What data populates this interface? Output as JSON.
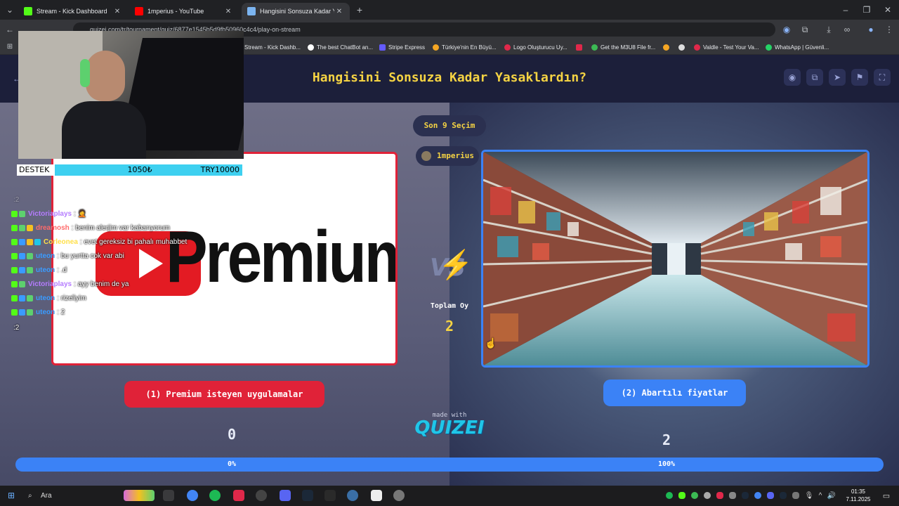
{
  "browser": {
    "tabs": [
      {
        "label": "Stream - Kick Dashboard",
        "favicon_color": "#53fc18"
      },
      {
        "label": "1mperius - YouTube",
        "favicon_color": "#ff0000"
      },
      {
        "label": "Hangisini Sonsuza Kadar Yasakl",
        "favicon_color": "#7bb4f0"
      }
    ],
    "new_tab_icon": "plus-icon",
    "url": "quizei.com/tr/tournament/quiz/6877e1545b5d9fb50960c4c4/play-on-stream",
    "bookmarks": [
      {
        "label": "Stream - Kick Dashb...",
        "color": "#53fc18"
      },
      {
        "label": "The best ChatBot an...",
        "color": "#ffffff"
      },
      {
        "label": "Stripe Express",
        "color": "#635bff"
      },
      {
        "label": "Türkiye'nin En Büyü...",
        "color": "#f5a623"
      },
      {
        "label": "Logo Oluşturucu Uy...",
        "color": "#e0284a"
      },
      {
        "label": "",
        "color": "#e0284a"
      },
      {
        "label": "Get the M3U8 File fr...",
        "color": "#3cba54"
      },
      {
        "label": "",
        "color": "#f5a623"
      },
      {
        "label": "",
        "color": "#dddddd"
      },
      {
        "label": "Valdle - Test Your Va...",
        "color": "#e0284a"
      },
      {
        "label": "WhatsApp | Güvenli...",
        "color": "#25d366"
      }
    ]
  },
  "quiz": {
    "title": "Hangisini Sonsuza Kadar Yasaklardın?",
    "last_pick_badge": "Son 9 Seçim",
    "user_badge": "1mperius",
    "vs_label": "VS",
    "total_votes_label": "Toplam Oy",
    "total_votes": "2",
    "left_option": {
      "label": "(1) Premium isteyen uygulamalar",
      "score": "0",
      "percent": "0%",
      "image_text": "Premium",
      "accent": "#e02238"
    },
    "right_option": {
      "label": "(2) Abartılı fiyatlar",
      "score": "2",
      "percent": "100%",
      "accent": "#3b82f6"
    },
    "left_share": 0,
    "made_with": "made with",
    "brand": "QUIZEI",
    "controls": [
      "eye-icon",
      "copy-icon",
      "send-icon",
      "flag-icon",
      "fullscreen-icon"
    ]
  },
  "overlay": {
    "donation": {
      "label": "DESTEK",
      "amount": "1050₺",
      "goal": "TRY10000"
    },
    "chat": [
      {
        "user": "",
        "message": ":2",
        "user_color": "#dddddd"
      },
      {
        "user": "Victoriaplays",
        "message": ": 🤦",
        "user_color": "#b57cff"
      },
      {
        "user": "dreamosh",
        "message": ": benim alerjim var kabarıyorum",
        "user_color": "#ff6a6a"
      },
      {
        "user": "Corleonea",
        "message": ": evet gereksiz bi pahalı muhabbet",
        "user_color": "#ffe04a"
      },
      {
        "user": "uteon",
        "message": ": bu yurtta cok var abi",
        "user_color": "#3a9bff"
      },
      {
        "user": "uteon",
        "message": ": .d",
        "user_color": "#3a9bff"
      },
      {
        "user": "Victoriaplays",
        "message": ": ayy benim de ya",
        "user_color": "#b57cff"
      },
      {
        "user": "uteon",
        "message": ": rizeliyim",
        "user_color": "#3a9bff"
      },
      {
        "user": "uteon",
        "message": ": 2",
        "user_color": "#3a9bff"
      },
      {
        "user": "",
        "message": ":2",
        "user_color": "#dddddd"
      }
    ]
  },
  "taskbar": {
    "search_placeholder": "Ara",
    "time": "01:35",
    "date": "7.11.2025"
  }
}
